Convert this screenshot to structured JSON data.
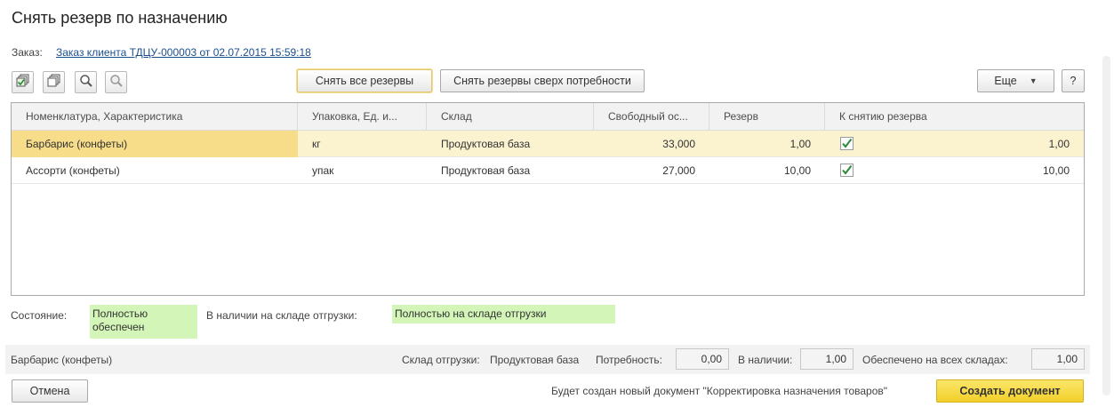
{
  "window": {
    "title": "Снять резерв по назначению"
  },
  "order": {
    "label": "Заказ:",
    "link": "Заказ клиента ТДЦУ-000003 от 02.07.2015 15:59:18"
  },
  "toolbar": {
    "icons": [
      "check-all-icon",
      "uncheck-all-icon",
      "search-icon",
      "clear-search-icon"
    ],
    "remove_all_label": "Снять все резервы",
    "remove_excess_label": "Снять резервы сверх потребности",
    "more_label": "Еще",
    "more_arrow": "▼",
    "help_label": "?"
  },
  "grid": {
    "columns": [
      "Номенклатура, Характеристика",
      "Упаковка, Ед. и...",
      "Склад",
      "Свободный ос...",
      "Резерв",
      "К снятию резерва"
    ],
    "rows": [
      {
        "item": "Барбарис (конфеты)",
        "unit": "кг",
        "warehouse": "Продуктовая база",
        "free": "33,000",
        "reserve": "1,00",
        "checked": true,
        "to_remove": "1,00",
        "selected": true
      },
      {
        "item": "Ассорти (конфеты)",
        "unit": "упак",
        "warehouse": "Продуктовая база",
        "free": "27,000",
        "reserve": "10,00",
        "checked": true,
        "to_remove": "10,00",
        "selected": false
      }
    ]
  },
  "status": {
    "state_label": "Состояние:",
    "state_value": "Полностью обеспечен",
    "availability_label": "В наличии на складе отгрузки:",
    "availability_value": "Полностью на складе отгрузки"
  },
  "footer_band": {
    "item_name": "Барбарис (конфеты)",
    "warehouse_label": "Склад отгрузки:",
    "warehouse_value": "Продуктовая база",
    "need_label": "Потребность:",
    "need_value": "0,00",
    "available_label": "В наличии:",
    "available_value": "1,00",
    "secured_label": "Обеспечено на всех складах:",
    "secured_value": "1,00"
  },
  "bottom": {
    "cancel_label": "Отмена",
    "info_text": "Будет создан новый документ \"Корректировка назначения товаров\"",
    "create_label": "Создать документ"
  },
  "colors": {
    "selected_row": "#fbf2cf",
    "status_green": "#d3f5b7",
    "primary_button": "#f5d63d",
    "link": "#1a4f8f",
    "check": "#2c8a3a"
  }
}
